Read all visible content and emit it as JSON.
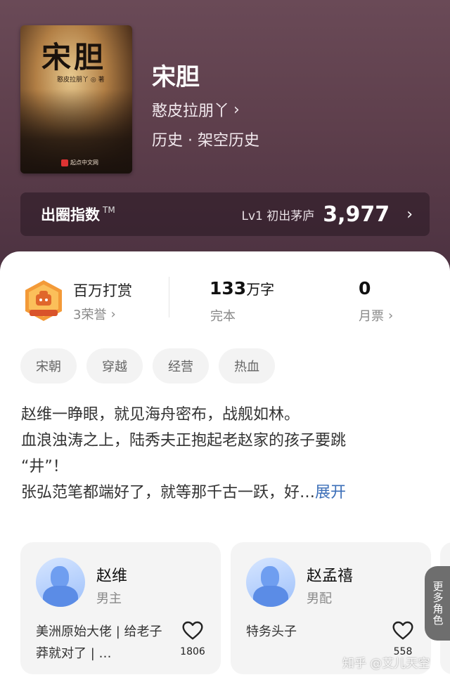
{
  "book": {
    "cover_title": "宋胆",
    "cover_author": "憨皮拉朋丫 ◎ 著",
    "cover_publisher": "起点中文网",
    "title": "宋胆",
    "author": "憨皮拉朋丫",
    "author_chevron": "›",
    "genre": "历史 · 架空历史"
  },
  "index_bar": {
    "label": "出圈指数",
    "tm": "TM",
    "level": "Lv1 初出茅庐",
    "value": "3,977",
    "chevron": "›"
  },
  "stats": {
    "award_title": "百万打赏",
    "award_sub": "3荣誉",
    "words_value": "133",
    "words_unit": "万字",
    "words_sub": "完本",
    "ticket_value": "0",
    "ticket_sub": "月票",
    "chevron": "›"
  },
  "tags": [
    "宋朝",
    "穿越",
    "经营",
    "热血"
  ],
  "description": {
    "line1": "赵维一睁眼，就见海舟密布，战舰如林。",
    "line2": "血浪浊涛之上，陆秀夫正抱起老赵家的孩子要跳",
    "line3": "“井”！",
    "line4": "张弘范笔都端好了，就等那千古一跃，好…",
    "expand": "展开"
  },
  "characters": [
    {
      "name": "赵维",
      "role": "男主",
      "desc": "美洲原始大佬 | 给老子莽就对了 | …",
      "likes": "1806"
    },
    {
      "name": "赵孟禧",
      "role": "男配",
      "desc": "特务头子",
      "likes": "558"
    }
  ],
  "more_roles": "更多角色",
  "watermark": "知乎 @艾儿天空",
  "colors": {
    "hero": "#5e3f4c",
    "link": "#3c6fb8",
    "avatar": "#9dc0fb"
  }
}
